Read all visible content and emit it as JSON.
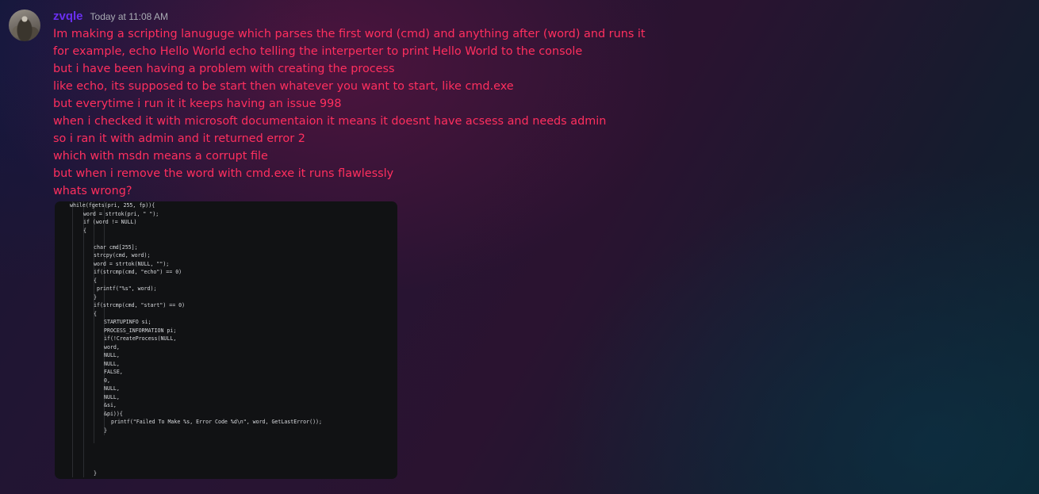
{
  "message": {
    "username": "zvqle",
    "timestamp": "Today at 11:08 AM",
    "avatar_icon": "user-avatar-photo",
    "username_color": "#6a2ff0",
    "text_color": "#ff2f5e",
    "lines": [
      "Im making a scripting lanuguge which parses the first word (cmd) and anything after (word) and runs it",
      "for example, echo Hello World echo telling the interperter to print Hello World to the console",
      "but i have been having a problem with creating the process",
      "like echo, its supposed to be start then whatever you want to start, like cmd.exe",
      "but everytime i run it it keeps having an issue 998",
      "when i checked it with microsoft documentaion it means it doesnt have acsess and needs admin",
      "so i ran it with admin and it returned error 2",
      "which with msdn means a corrupt file",
      "but when i remove the word with cmd.exe it runs flawlessly",
      "whats wrong?"
    ]
  },
  "attachment": {
    "type": "code-screenshot",
    "background": "#111214",
    "code_lines": [
      "while(fgets(pri, 255, fp)){",
      "word = strtok(pri, \" \");",
      "if (word != NULL)",
      "{",
      "",
      "char cmd[255];",
      "strcpy(cmd, word);",
      "word = strtok(NULL, \"\");",
      "if(strcmp(cmd, \"echo\") == 0)",
      "{",
      "printf(\"%s\", word);",
      "}",
      "if(strcmp(cmd, \"start\") == 0)",
      "{",
      "STARTUPINFO si;",
      "PROCESS_INFORMATION pi;",
      "if(!CreateProcess(NULL,",
      "word,",
      "NULL,",
      "NULL,",
      "FALSE,",
      "0,",
      "NULL,",
      "NULL,",
      "&si,",
      "&pi)){",
      "printf(\"Failed To Make %s, Error Code %d\\n\", word, GetLastError());",
      "}",
      "",
      "",
      "",
      "",
      "",
      "}"
    ]
  }
}
